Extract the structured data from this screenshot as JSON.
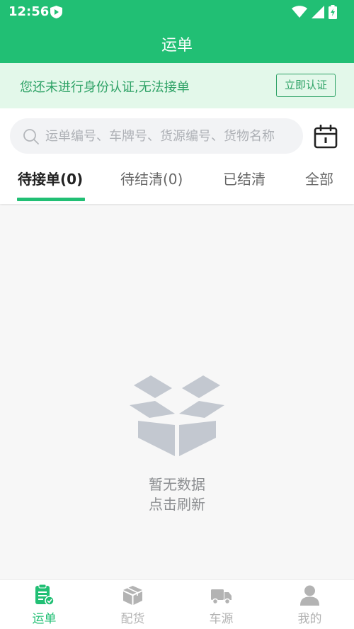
{
  "status_bar": {
    "time": "12:56",
    "icons": [
      "shield-icon",
      "wifi-icon",
      "signal-icon",
      "battery-charging-icon"
    ]
  },
  "header": {
    "title": "运单"
  },
  "notice": {
    "text": "您还未进行身份认证,无法接单",
    "button_label": "立即认证"
  },
  "search": {
    "placeholder": "运单编号、车牌号、货源编号、货物名称",
    "value": ""
  },
  "tabs": [
    {
      "label": "待接单(0)",
      "active": true
    },
    {
      "label": "待结清(0)",
      "active": false
    },
    {
      "label": "已结清",
      "active": false
    },
    {
      "label": "全部",
      "active": false
    }
  ],
  "empty_state": {
    "line1": "暂无数据",
    "line2": "点击刷新",
    "icon": "empty-box-icon"
  },
  "bottom_nav": [
    {
      "label": "运单",
      "icon": "waybill-icon",
      "active": true
    },
    {
      "label": "配货",
      "icon": "cargo-box-icon",
      "active": false
    },
    {
      "label": "车源",
      "icon": "truck-icon",
      "active": false
    },
    {
      "label": "我的",
      "icon": "profile-icon",
      "active": false
    }
  ],
  "colors": {
    "primary": "#21bf74",
    "notice_bg": "#e3f8ea",
    "notice_text": "#2ea266",
    "inactive": "#b3b3b3",
    "empty_icon": "#c3c8d0"
  }
}
